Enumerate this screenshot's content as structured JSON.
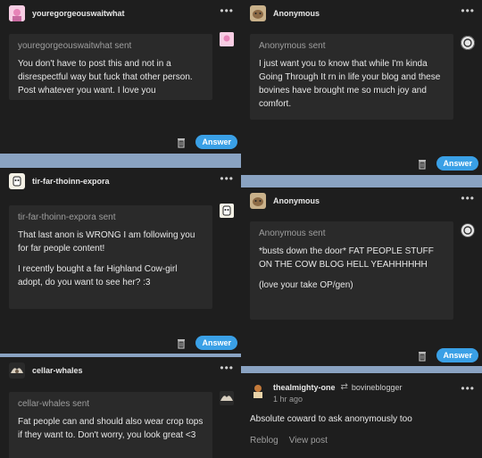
{
  "cards": [
    {
      "username": "youregorgeouswaitwhat",
      "ask_from": "youregorgeouswaitwhat sent",
      "ask_text": "You don't have to post this and not in a disrespectful way but fuck that other person. Post whatever you want. I love you",
      "answer_label": "Answer"
    },
    {
      "username": "Anonymous",
      "ask_from": "Anonymous sent",
      "ask_text": "I just want you to know that while I'm kinda Going Through It rn in life your blog and these bovines have brought me so much joy and comfort.",
      "answer_label": "Answer"
    },
    {
      "username": "tir-far-thoinn-expora",
      "ask_from": "tir-far-thoinn-expora sent",
      "ask_text_1": "That last anon is WRONG I am following you for far people content!",
      "ask_text_2": "I recently bought a far Highland Cow-girl adopt, do you want to see her? :3",
      "answer_label": "Answer"
    },
    {
      "username": "Anonymous",
      "ask_from": "Anonymous sent",
      "ask_text_1": "*busts down the door* FAT PEOPLE STUFF ON THE COW BLOG HELL YEAHHHHHH",
      "ask_text_2": "(love your take OP/gen)",
      "answer_label": "Answer"
    },
    {
      "username": "cellar-whales",
      "ask_from": "cellar-whales sent",
      "ask_text": "Fat people can and should also wear crop tops if they want to. Don't worry, you look great <3"
    },
    {
      "username": "thealmighty-one",
      "reblog_from": "bovineblogger",
      "time": "1 hr ago",
      "body": "Absolute coward to ask anonymously too",
      "reblog_label": "Reblog",
      "view_label": "View post"
    }
  ],
  "menu_glyph": "•••"
}
